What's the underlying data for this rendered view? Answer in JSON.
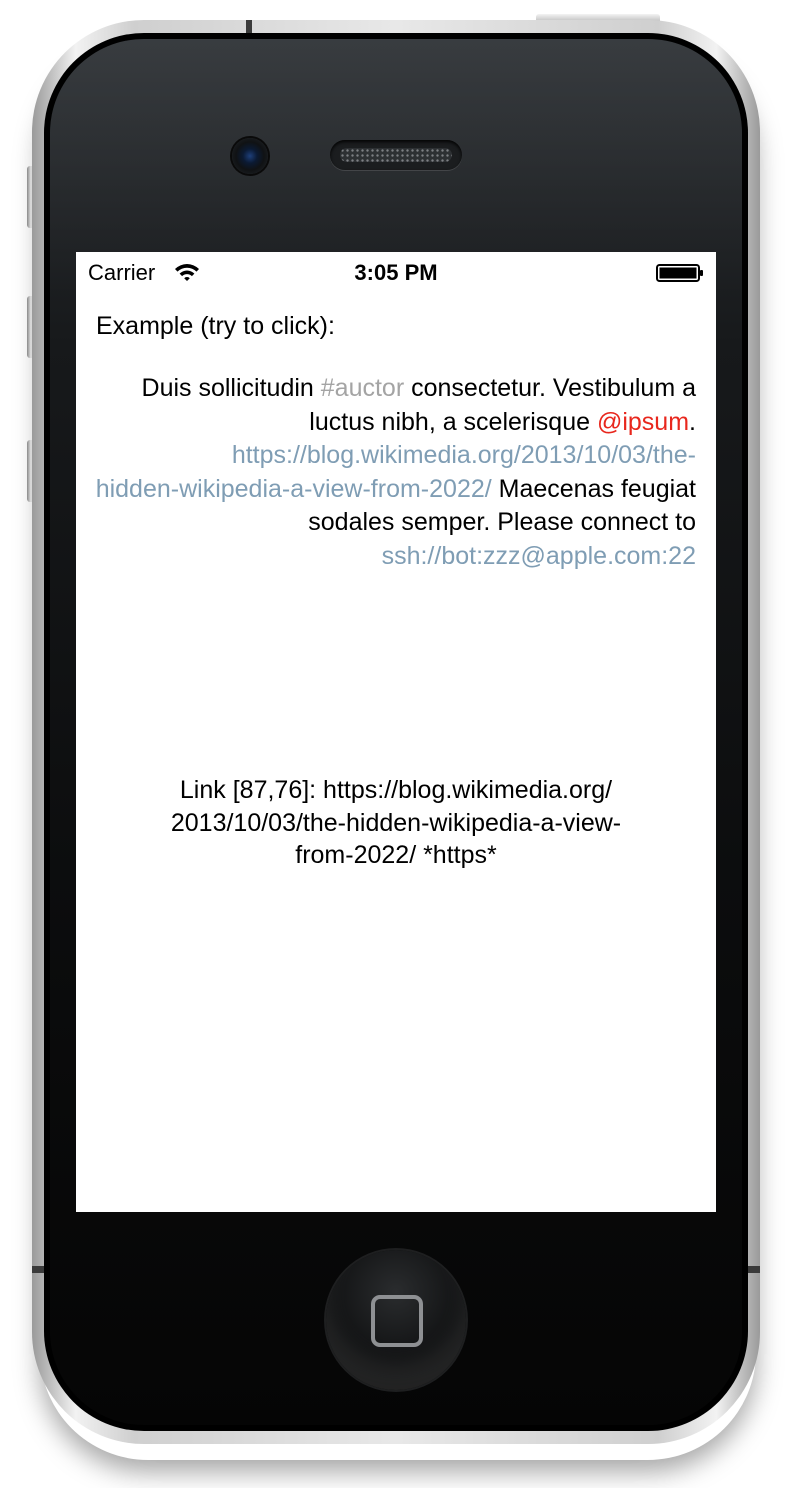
{
  "status_bar": {
    "carrier": "Carrier",
    "time": "3:05 PM",
    "wifi_icon": "wifi-icon",
    "battery_icon": "battery-full-icon"
  },
  "content": {
    "example_label": "Example (try to click):",
    "paragraph": {
      "text1": "Duis sollicitudin ",
      "hashtag": "#auctor",
      "text2": " consectetur. Vestibulum a luctus nibh, a scelerisque ",
      "mention": "@ipsum",
      "text3": ". ",
      "url1_line1": "https://blog.wikimedia.org/2013/10/03/the-",
      "url1_line2": "hidden-wikipedia-a-view-from-2022/",
      "text4": " Maecenas feugiat sodales semper. Please connect to ",
      "url2": "ssh://bot:zzz@apple.com:22"
    },
    "link_info": {
      "line1": "Link [87,76]: https://blog.wikimedia.org/",
      "line2": "2013/10/03/the-hidden-wikipedia-a-view-",
      "line3": "from-2022/ *https*"
    }
  },
  "colors": {
    "hashtag": "#a4a4a4",
    "mention": "#e8271d",
    "url": "#7f9db4"
  }
}
